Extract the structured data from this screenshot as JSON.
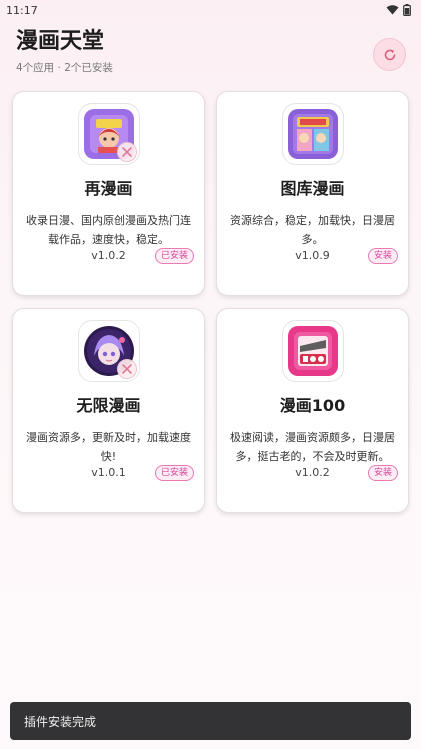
{
  "status_bar": {
    "time": "11:17"
  },
  "header": {
    "title": "漫画天堂",
    "subtitle": "4个应用 · 2个已安装"
  },
  "plugins": [
    {
      "name": "再漫画",
      "description": "收录日漫、国内原创漫画及热门连载作品，速度快，稳定。",
      "version": "v1.0.2",
      "status": "已安装"
    },
    {
      "name": "图库漫画",
      "description": "资源综合，稳定，加载快，日漫居多。",
      "version": "v1.0.9",
      "status": "安装"
    },
    {
      "name": "无限漫画",
      "description": "漫画资源多，更新及时，加载速度快!",
      "version": "v1.0.1",
      "status": "已安装"
    },
    {
      "name": "漫画100",
      "description": "极速阅读，漫画资源颇多，日漫居多，挺古老的，不会及时更新。",
      "version": "v1.0.2",
      "status": "安装"
    }
  ],
  "toast": {
    "message": "插件安装完成"
  },
  "colors": {
    "accent": "#e97ab3",
    "badge_text": "#d4479a",
    "toast_bg": "#333335"
  }
}
